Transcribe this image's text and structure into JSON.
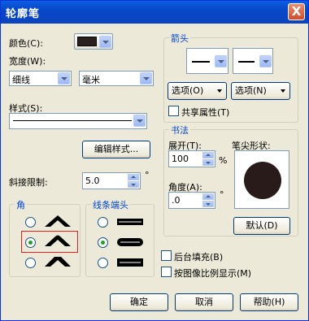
{
  "dialog": {
    "title": "轮廓笔",
    "close_symbol": "X"
  },
  "color": {
    "label": "颜色(C):",
    "swatch": "#2a2020"
  },
  "width": {
    "label": "宽度(W):",
    "value": "细线",
    "unit": "毫米"
  },
  "style": {
    "label": "样式(S):",
    "edit_button": "编辑样式..."
  },
  "miter": {
    "label": "斜接限制:",
    "value": "5.0",
    "unit": "°"
  },
  "corners": {
    "title": "角"
  },
  "line_caps": {
    "title": "线条端头"
  },
  "arrows": {
    "title": "箭头",
    "options_left": "选项(O)",
    "options_right": "选项(N)",
    "share_attrs": "共享属性(T)"
  },
  "calligraphy": {
    "title": "书法",
    "stretch_label": "展开(T):",
    "stretch_value": "100",
    "stretch_unit": "%",
    "angle_label": "角度(A):",
    "angle_value": ".0",
    "angle_unit": "°",
    "nib_label": "笔尖形状:",
    "default_button": "默认(D)"
  },
  "behind_fill": "后台填充(B)",
  "scale_with_image": "按图像比例显示(M)",
  "buttons": {
    "ok": "确定",
    "cancel": "取消",
    "help": "帮助(H)"
  }
}
